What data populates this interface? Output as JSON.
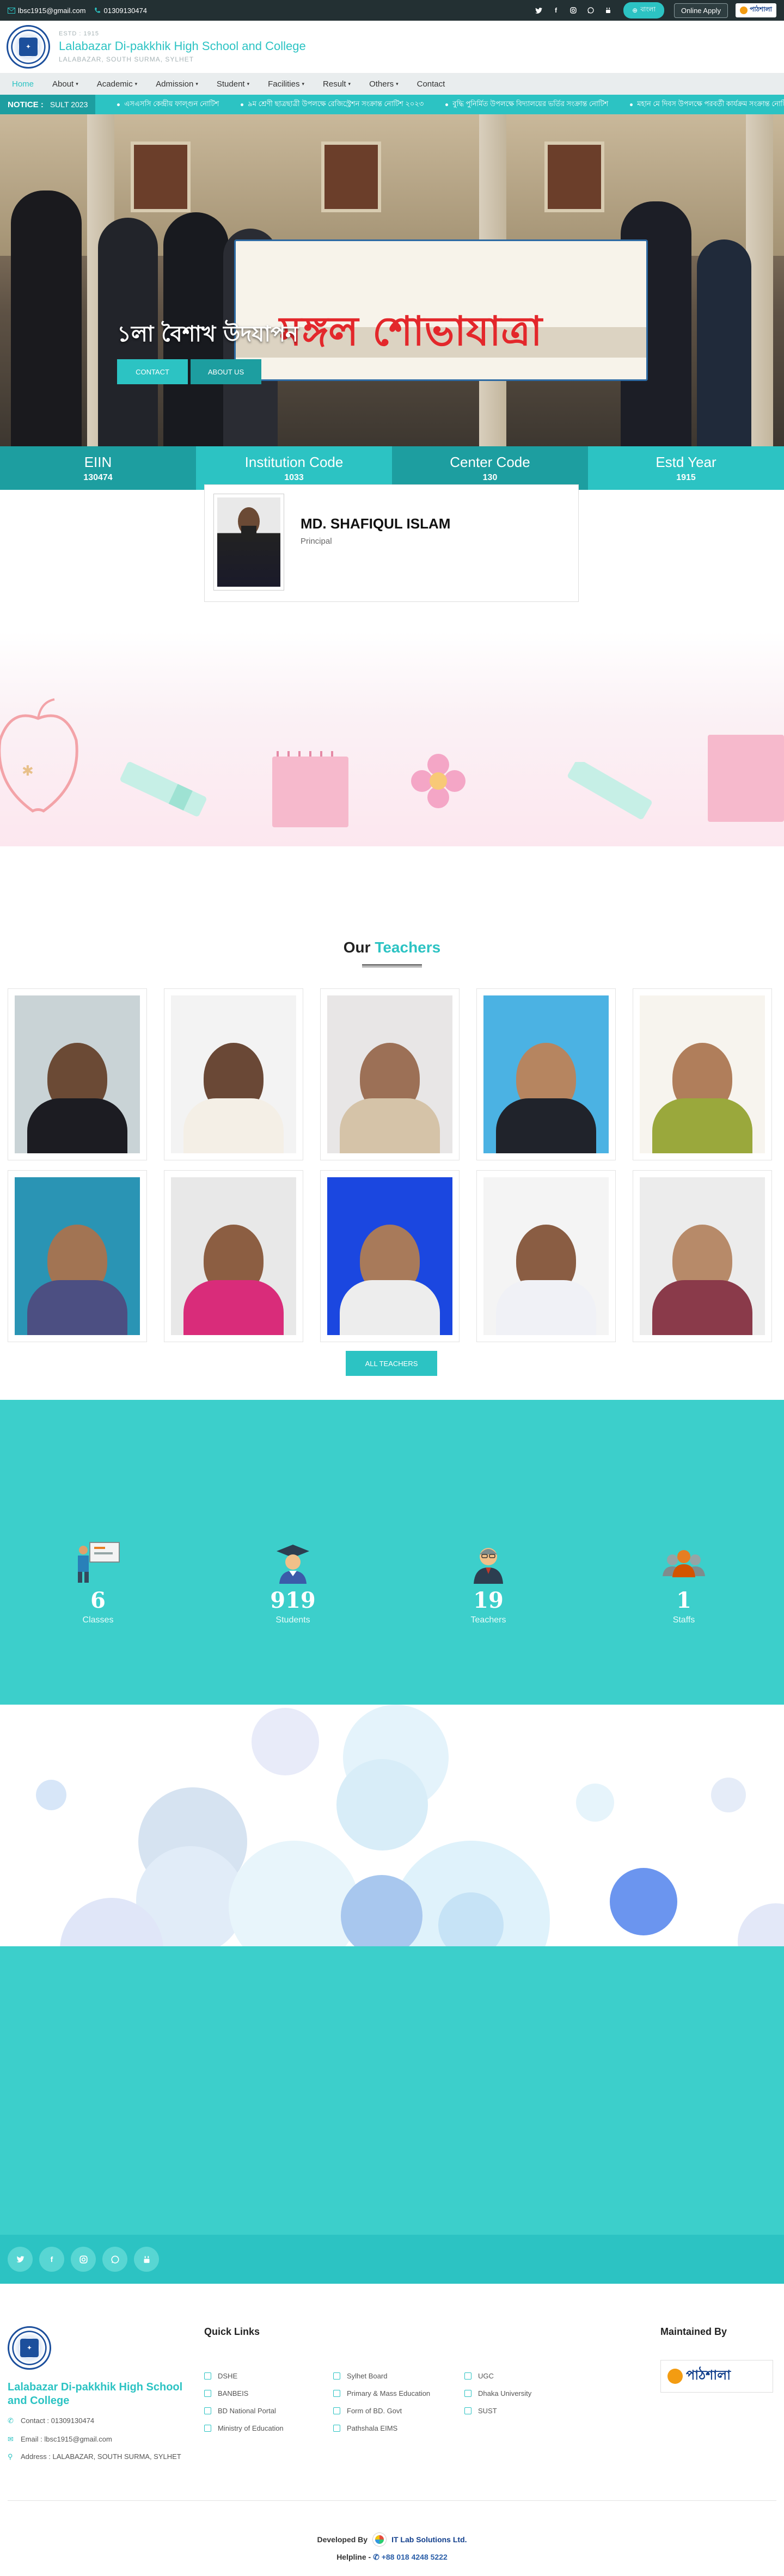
{
  "topbar": {
    "email": "lbsc1915@gmail.com",
    "phone": "01309130474",
    "lang_label": "বাংলা",
    "online_apply": "Online Apply",
    "pathshala_label": "পাঠশালা"
  },
  "header": {
    "estd": "ESTD : 1915",
    "school_name": "Lalabazar Di-pakkhik High School and College",
    "address": "LALABAZAR, SOUTH SURMA, SYLHET"
  },
  "nav": {
    "items": [
      {
        "label": "Home",
        "dropdown": false,
        "active": true
      },
      {
        "label": "About",
        "dropdown": true
      },
      {
        "label": "Academic",
        "dropdown": true
      },
      {
        "label": "Admission",
        "dropdown": true
      },
      {
        "label": "Student",
        "dropdown": true
      },
      {
        "label": "Facilities",
        "dropdown": true
      },
      {
        "label": "Result",
        "dropdown": true
      },
      {
        "label": "Others",
        "dropdown": true
      },
      {
        "label": "Contact",
        "dropdown": false
      }
    ]
  },
  "notice": {
    "label": "NOTICE :",
    "date": "SULT 2023",
    "items": [
      "এসএসসি কেন্দ্রীয় ফাল্গুন নোটিশ",
      "৯ম শ্রেণী ছাত্রছাত্রী উপলক্ষে রেজিস্ট্রেশন সংক্রান্ত নোটিশ ২০২৩",
      "বুদ্ধি পুনির্মিত উপলক্ষে বিদ্যালয়ের ভর্তির সংক্রান্ত নোটিশ",
      "মহান মে দিবস উপলক্ষে পরবর্তী কার্যক্রম সংক্রান্ত নোটিশ"
    ]
  },
  "hero": {
    "caption": "১লা বৈশাখ উদযাপন",
    "banner_title": "মঙ্গল শোভাযাত্রা",
    "contact_btn": "CONTACT",
    "about_btn": "ABOUT US"
  },
  "stats_strip": [
    {
      "title": "EIIN",
      "value": "130474",
      "color": "#1d9ea0"
    },
    {
      "title": "Institution Code",
      "value": "1033",
      "color": "#2cc3c3"
    },
    {
      "title": "Center Code",
      "value": "130",
      "color": "#1d9ea0"
    },
    {
      "title": "Estd Year",
      "value": "1915",
      "color": "#2cc3c3"
    }
  ],
  "principal": {
    "name": "MD. SHAFIQUL ISLAM",
    "role": "Principal"
  },
  "teachers": {
    "title_part1": "Our",
    "title_part2": "Teachers",
    "all_button": "ALL TEACHERS"
  },
  "counters": [
    {
      "value": "6",
      "label": "Classes",
      "icon": "classroom-icon"
    },
    {
      "value": "919",
      "label": "Students",
      "icon": "graduate-icon"
    },
    {
      "value": "19",
      "label": "Teachers",
      "icon": "teacher-icon"
    },
    {
      "value": "1",
      "label": "Staffs",
      "icon": "staff-group-icon"
    }
  ],
  "footer": {
    "school_name": "Lalabazar Di-pakkhik High School and College",
    "contact": "Contact : 01309130474",
    "email": "Email : lbsc1915@gmail.com",
    "address": "Address : LALABAZAR, SOUTH SURMA, SYLHET",
    "quick_links_title": "Quick Links",
    "maintained_by_title": "Maintained By",
    "maintained_by": "পাঠশালা",
    "quick_links": [
      [
        "DSHE",
        "BANBEIS",
        "BD National Portal",
        "Ministry of Education"
      ],
      [
        "Sylhet Board",
        "Primary & Mass Education",
        "Form of BD. Govt",
        "Pathshala EIMS"
      ],
      [
        "UGC",
        "Dhaka University",
        "SUST"
      ]
    ],
    "developed_by": "Developed By",
    "developer": "IT Lab Solutions Ltd.",
    "helpline_label": "Helpline -",
    "helpline": "+88 018 4248 5222"
  },
  "colors": {
    "accent": "#2cc3c3",
    "accent_dark": "#1d9ea0",
    "topbar": "#233033"
  }
}
